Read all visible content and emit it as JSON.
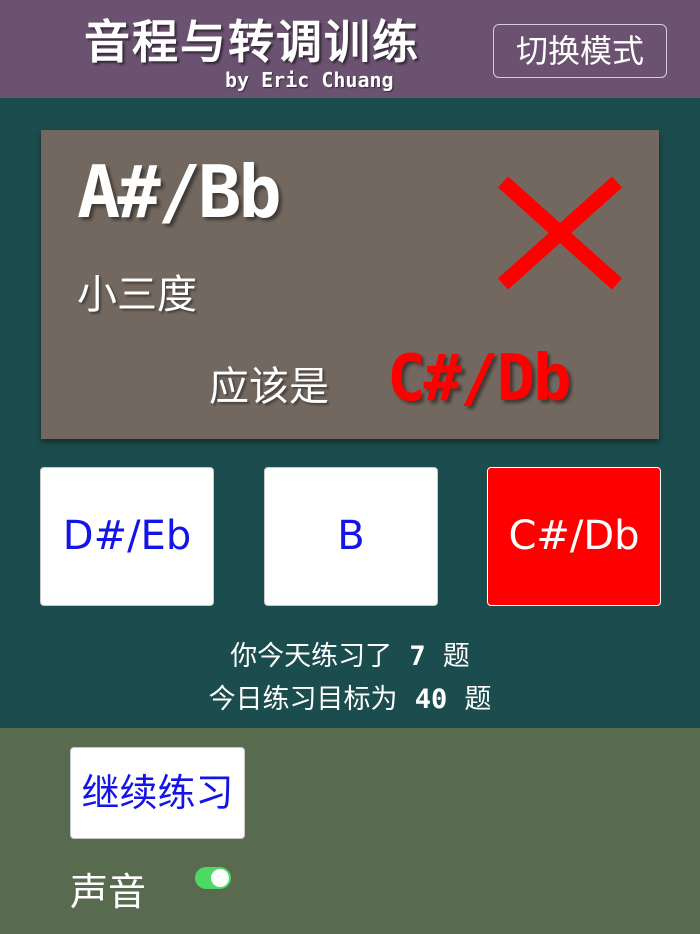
{
  "header": {
    "title": "音程与转调训练",
    "byline": "by Eric Chuang",
    "mode_button": "切换模式"
  },
  "question": {
    "note": "A#/Bb",
    "interval": "小三度",
    "result_icon": "wrong-x-icon",
    "should_be_label": "应该是",
    "correct_answer": "C#/Db"
  },
  "choices": [
    {
      "label": "D#/Eb",
      "state": "normal"
    },
    {
      "label": "B",
      "state": "normal"
    },
    {
      "label": "C#/Db",
      "state": "wrong"
    }
  ],
  "stats": {
    "today_prefix": "你今天练习了",
    "today_count": "7",
    "today_suffix": "题",
    "goal_prefix": "今日练习目标为",
    "goal_count": "40",
    "goal_suffix": "题"
  },
  "footer": {
    "continue_button": "继续练习",
    "sound_label": "声音",
    "sound_on": true
  },
  "colors": {
    "header_bg": "#6b5270",
    "main_bg": "#1c4d4e",
    "card_bg": "#726860",
    "footer_bg": "#596b4f",
    "accent_red": "#ff0000",
    "choice_text": "#1414e8",
    "toggle_on": "#4cd964"
  }
}
